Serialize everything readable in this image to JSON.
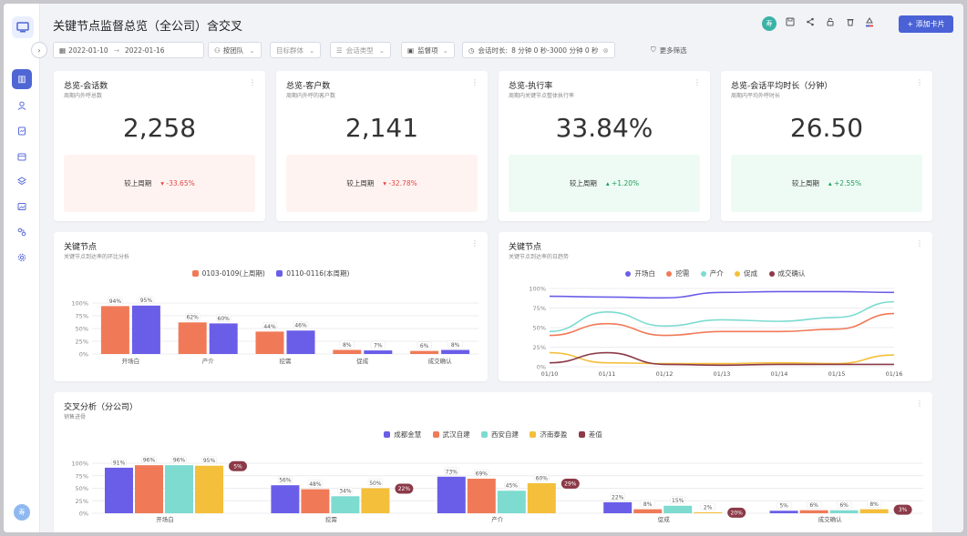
{
  "header": {
    "title": "关键节点监督总览（全公司）含交叉",
    "user_initial": "寿",
    "add_card_label": "+ 添加卡片"
  },
  "sidebar": {
    "user_initial": "寿"
  },
  "filters": {
    "expand_icon": "›",
    "date_start": "2022-01-10",
    "date_end": "2022-01-16",
    "by_team": "按团队",
    "target_group": "目标群体",
    "session_type": "会话类型",
    "supervisor": "监督项",
    "duration_label": "会话时长:",
    "duration_value": "8 分钟 0 秒-3000 分钟 0 秒",
    "more_filters": "更多筛选"
  },
  "kpis": [
    {
      "title": "总览-会话数",
      "subtitle": "周期内外呼总数",
      "value": "2,258",
      "compare_label": "较上周期",
      "delta": "-33.65%",
      "trend": "down"
    },
    {
      "title": "总览-客户数",
      "subtitle": "周期内外呼的客户数",
      "value": "2,141",
      "compare_label": "较上周期",
      "delta": "-32.78%",
      "trend": "down"
    },
    {
      "title": "总览-执行率",
      "subtitle": "周期内关键节点整体执行率",
      "value": "33.84%",
      "compare_label": "较上周期",
      "delta": "+1.20%",
      "trend": "up"
    },
    {
      "title": "总览-会话平均时长（分钟）",
      "subtitle": "周期内平均外呼时长",
      "value": "26.50",
      "compare_label": "较上周期",
      "delta": "+2.55%",
      "trend": "up"
    }
  ],
  "colors": {
    "orange": "#f07a58",
    "purple": "#6a5ee8",
    "cyan": "#7ddbd0",
    "yellow": "#f4bf3a",
    "maroon": "#8c3a48",
    "primary": "#4a62d6"
  },
  "chart_data": [
    {
      "type": "bar",
      "title": "关键节点",
      "subtitle": "关键节点到达率的环比分析",
      "categories": [
        "开场白",
        "产介",
        "挖需",
        "促成",
        "成交确认"
      ],
      "series": [
        {
          "name": "0103-0109(上周期)",
          "color": "#f07a58",
          "values": [
            94,
            62,
            44,
            8,
            6
          ],
          "labels": [
            "94%",
            "62%",
            "44%",
            "8%",
            "6%"
          ]
        },
        {
          "name": "0110-0116(本周期)",
          "color": "#6a5ee8",
          "values": [
            95,
            60,
            46,
            7,
            8
          ],
          "labels": [
            "95%",
            "60%",
            "46%",
            "7%",
            "8%"
          ]
        }
      ],
      "y_ticks": [
        "0%",
        "25%",
        "50%",
        "75%",
        "100%"
      ],
      "ylim": [
        0,
        100
      ]
    },
    {
      "type": "line",
      "title": "关键节点",
      "subtitle": "关键节点到达率的日趋势",
      "x": [
        "01/10",
        "01/11",
        "01/12",
        "01/13",
        "01/14",
        "01/15",
        "01/16"
      ],
      "y_ticks": [
        "0%",
        "25%",
        "50%",
        "75%",
        "100%"
      ],
      "ylim": [
        0,
        100
      ],
      "series": [
        {
          "name": "开场白",
          "color": "#6a5ee8",
          "values": [
            90,
            89,
            88,
            95,
            96,
            96,
            95
          ]
        },
        {
          "name": "挖需",
          "color": "#f07a58",
          "values": [
            40,
            55,
            40,
            45,
            45,
            48,
            68
          ]
        },
        {
          "name": "产介",
          "color": "#7ddbd0",
          "values": [
            45,
            70,
            52,
            60,
            58,
            63,
            83
          ]
        },
        {
          "name": "促成",
          "color": "#f4bf3a",
          "values": [
            18,
            5,
            4,
            4,
            5,
            4,
            15
          ]
        },
        {
          "name": "成交确认",
          "color": "#8c3a48",
          "values": [
            5,
            18,
            3,
            2,
            3,
            3,
            3
          ]
        }
      ]
    },
    {
      "type": "bar",
      "title": "交叉分析（分公司）",
      "subtitle": "销售进骨",
      "categories": [
        "开场白",
        "挖需",
        "产介",
        "促成",
        "成交确认"
      ],
      "y_ticks": [
        "0%",
        "25%",
        "50%",
        "75%",
        "100%"
      ],
      "ylim": [
        0,
        100
      ],
      "series": [
        {
          "name": "成都金慧",
          "color": "#6a5ee8",
          "values": [
            91,
            56,
            73,
            22,
            5
          ],
          "labels": [
            "91%",
            "56%",
            "73%",
            "22%",
            "5%"
          ]
        },
        {
          "name": "武汉自建",
          "color": "#f07a58",
          "values": [
            96,
            48,
            69,
            8,
            6
          ],
          "labels": [
            "96%",
            "48%",
            "69%",
            "8%",
            "6%"
          ]
        },
        {
          "name": "西安自建",
          "color": "#7ddbd0",
          "values": [
            96,
            34,
            45,
            15,
            6
          ],
          "labels": [
            "96%",
            "34%",
            "45%",
            "15%",
            "6%"
          ]
        },
        {
          "name": "济南泰盈",
          "color": "#f4bf3a",
          "values": [
            95,
            50,
            60,
            2,
            8
          ],
          "labels": [
            "95%",
            "50%",
            "60%",
            "2%",
            "8%"
          ]
        }
      ],
      "diff": {
        "name": "差值",
        "color": "#8c3a48",
        "labels": [
          "5%",
          "22%",
          "29%",
          "20%",
          "3%"
        ]
      }
    }
  ]
}
